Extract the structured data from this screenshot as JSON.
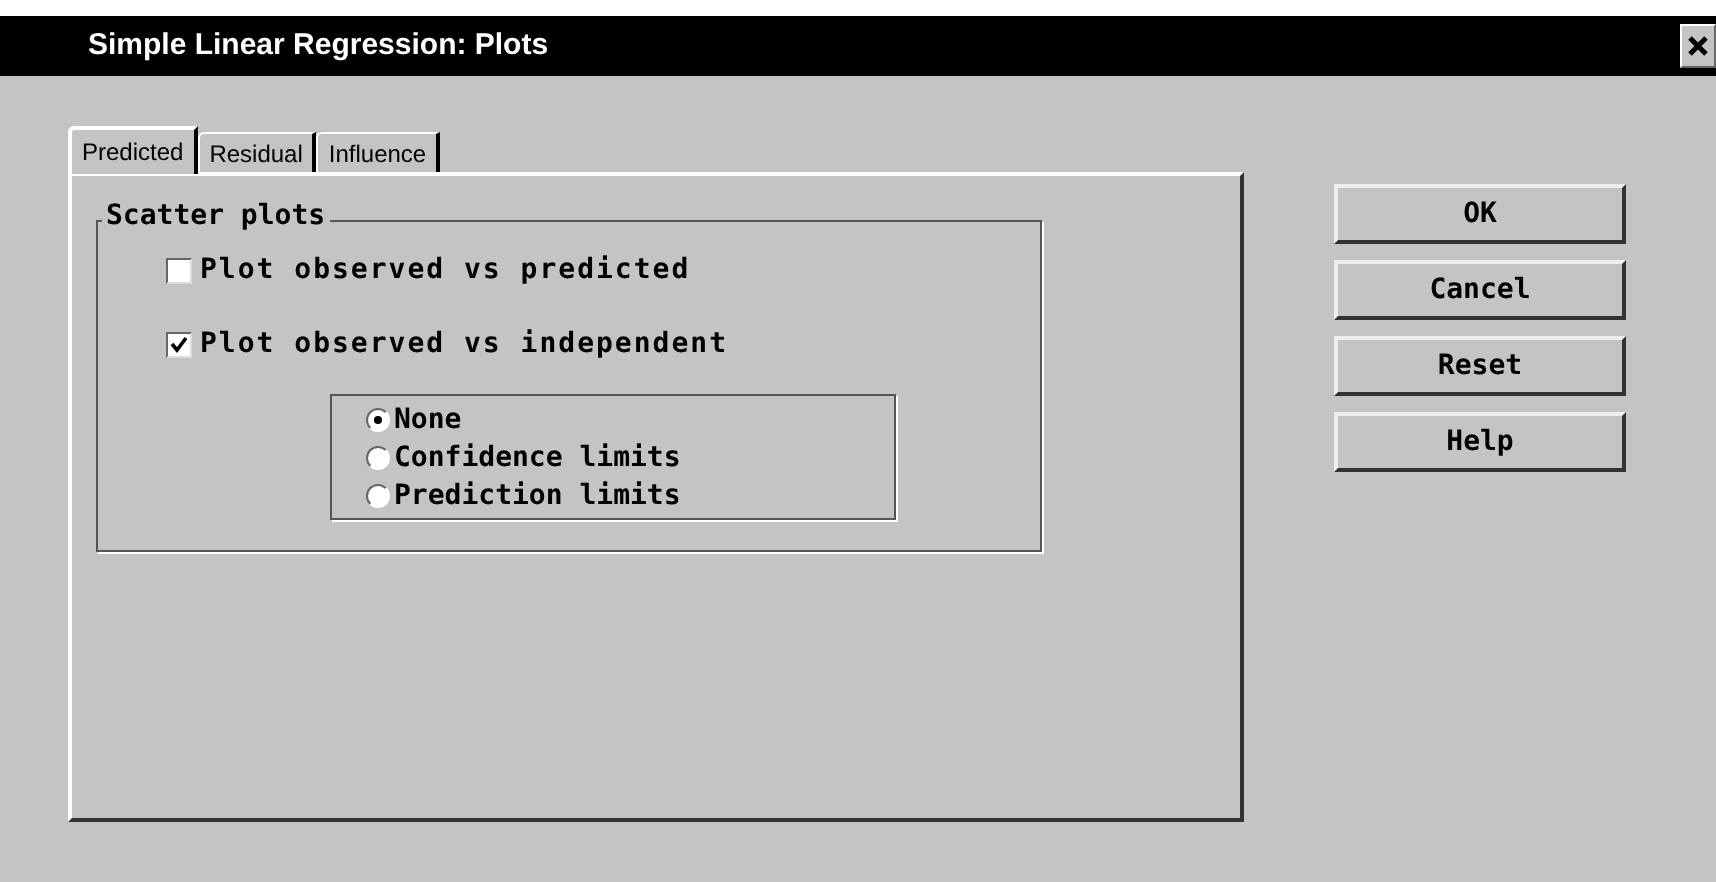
{
  "window": {
    "title": "Simple Linear Regression:  Plots"
  },
  "tabs": [
    {
      "label": "Predicted",
      "selected": true
    },
    {
      "label": "Residual",
      "selected": false
    },
    {
      "label": "Influence",
      "selected": false
    }
  ],
  "group": {
    "title": "Scatter plots",
    "checkboxes": [
      {
        "label": "Plot observed vs predicted",
        "checked": false
      },
      {
        "label": "Plot observed vs independent",
        "checked": true
      }
    ],
    "radios": [
      {
        "label": "None",
        "selected": true
      },
      {
        "label": "Confidence limits",
        "selected": false
      },
      {
        "label": "Prediction limits",
        "selected": false
      }
    ]
  },
  "buttons": [
    "OK",
    "Cancel",
    "Reset",
    "Help"
  ]
}
